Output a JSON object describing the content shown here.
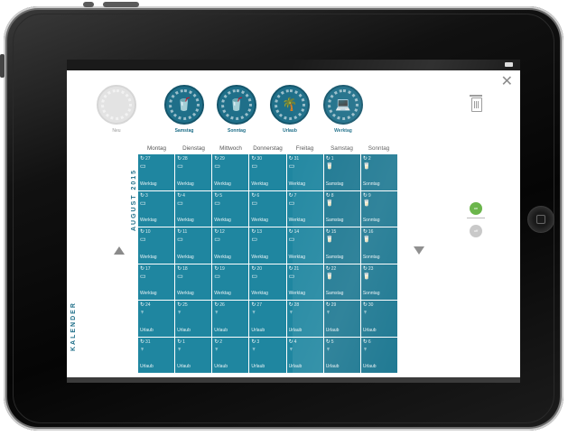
{
  "picker": [
    {
      "label": "Neu",
      "icon": "",
      "style": "grey"
    },
    {
      "label": "Samstag",
      "icon": "drink-cup-icon",
      "style": "teal"
    },
    {
      "label": "Sonntag",
      "icon": "drink-cup-icon",
      "style": "teal"
    },
    {
      "label": "Urlaub",
      "icon": "palm-tree-icon",
      "style": "teal"
    },
    {
      "label": "Werktag",
      "icon": "laptop-icon",
      "style": "teal"
    }
  ],
  "sidebar": {
    "title": "KALENDER"
  },
  "month_label": "AUGUST 2015",
  "weekdays": [
    "Montag",
    "Dienstag",
    "Mittwoch",
    "Donnerstag",
    "Freitag",
    "Samstag",
    "Sonntag"
  ],
  "weeks": [
    [
      {
        "day": "27",
        "label": "Werktag",
        "icon": "laptop-icon"
      },
      {
        "day": "28",
        "label": "Werktag",
        "icon": "laptop-icon"
      },
      {
        "day": "29",
        "label": "Werktag",
        "icon": "laptop-icon"
      },
      {
        "day": "30",
        "label": "Werktag",
        "icon": "laptop-icon"
      },
      {
        "day": "31",
        "label": "Werktag",
        "icon": "laptop-icon"
      },
      {
        "day": "1",
        "label": "Samstag",
        "icon": "drink-cup-icon"
      },
      {
        "day": "2",
        "label": "Sonntag",
        "icon": "drink-cup-icon"
      }
    ],
    [
      {
        "day": "3",
        "label": "Werktag",
        "icon": "laptop-icon"
      },
      {
        "day": "4",
        "label": "Werktag",
        "icon": "laptop-icon"
      },
      {
        "day": "5",
        "label": "Werktag",
        "icon": "laptop-icon"
      },
      {
        "day": "6",
        "label": "Werktag",
        "icon": "laptop-icon"
      },
      {
        "day": "7",
        "label": "Werktag",
        "icon": "laptop-icon"
      },
      {
        "day": "8",
        "label": "Samstag",
        "icon": "drink-cup-icon"
      },
      {
        "day": "9",
        "label": "Sonntag",
        "icon": "drink-cup-icon"
      }
    ],
    [
      {
        "day": "10",
        "label": "Werktag",
        "icon": "laptop-icon"
      },
      {
        "day": "11",
        "label": "Werktag",
        "icon": "laptop-icon"
      },
      {
        "day": "12",
        "label": "Werktag",
        "icon": "laptop-icon"
      },
      {
        "day": "13",
        "label": "Werktag",
        "icon": "laptop-icon"
      },
      {
        "day": "14",
        "label": "Werktag",
        "icon": "laptop-icon"
      },
      {
        "day": "15",
        "label": "Samstag",
        "icon": "drink-cup-icon"
      },
      {
        "day": "16",
        "label": "Sonntag",
        "icon": "drink-cup-icon"
      }
    ],
    [
      {
        "day": "17",
        "label": "Werktag",
        "icon": "laptop-icon"
      },
      {
        "day": "18",
        "label": "Werktag",
        "icon": "laptop-icon"
      },
      {
        "day": "19",
        "label": "Werktag",
        "icon": "laptop-icon"
      },
      {
        "day": "20",
        "label": "Werktag",
        "icon": "laptop-icon"
      },
      {
        "day": "21",
        "label": "Werktag",
        "icon": "laptop-icon"
      },
      {
        "day": "22",
        "label": "Samstag",
        "icon": "drink-cup-icon"
      },
      {
        "day": "23",
        "label": "Sonntag",
        "icon": "drink-cup-icon"
      }
    ],
    [
      {
        "day": "24",
        "label": "Urlaub",
        "icon": "palm-tree-icon"
      },
      {
        "day": "25",
        "label": "Urlaub",
        "icon": "palm-tree-icon"
      },
      {
        "day": "26",
        "label": "Urlaub",
        "icon": "palm-tree-icon"
      },
      {
        "day": "27",
        "label": "Urlaub",
        "icon": "palm-tree-icon"
      },
      {
        "day": "28",
        "label": "Urlaub",
        "icon": "palm-tree-icon"
      },
      {
        "day": "29",
        "label": "Urlaub",
        "icon": "palm-tree-icon"
      },
      {
        "day": "30",
        "label": "Urlaub",
        "icon": "palm-tree-icon"
      }
    ],
    [
      {
        "day": "31",
        "label": "Urlaub",
        "icon": "palm-tree-icon"
      },
      {
        "day": "1",
        "label": "Urlaub",
        "icon": "palm-tree-icon"
      },
      {
        "day": "2",
        "label": "Urlaub",
        "icon": "palm-tree-icon"
      },
      {
        "day": "3",
        "label": "Urlaub",
        "icon": "palm-tree-icon"
      },
      {
        "day": "4",
        "label": "Urlaub",
        "icon": "palm-tree-icon"
      },
      {
        "day": "5",
        "label": "Urlaub",
        "icon": "palm-tree-icon"
      },
      {
        "day": "6",
        "label": "Urlaub",
        "icon": "palm-tree-icon"
      }
    ]
  ],
  "toggle": {
    "on_label": "on",
    "off_label": "off"
  },
  "colors": {
    "teal": "#1f86a0",
    "teal_dark": "#1f6f89",
    "on_green": "#6ab54a"
  }
}
